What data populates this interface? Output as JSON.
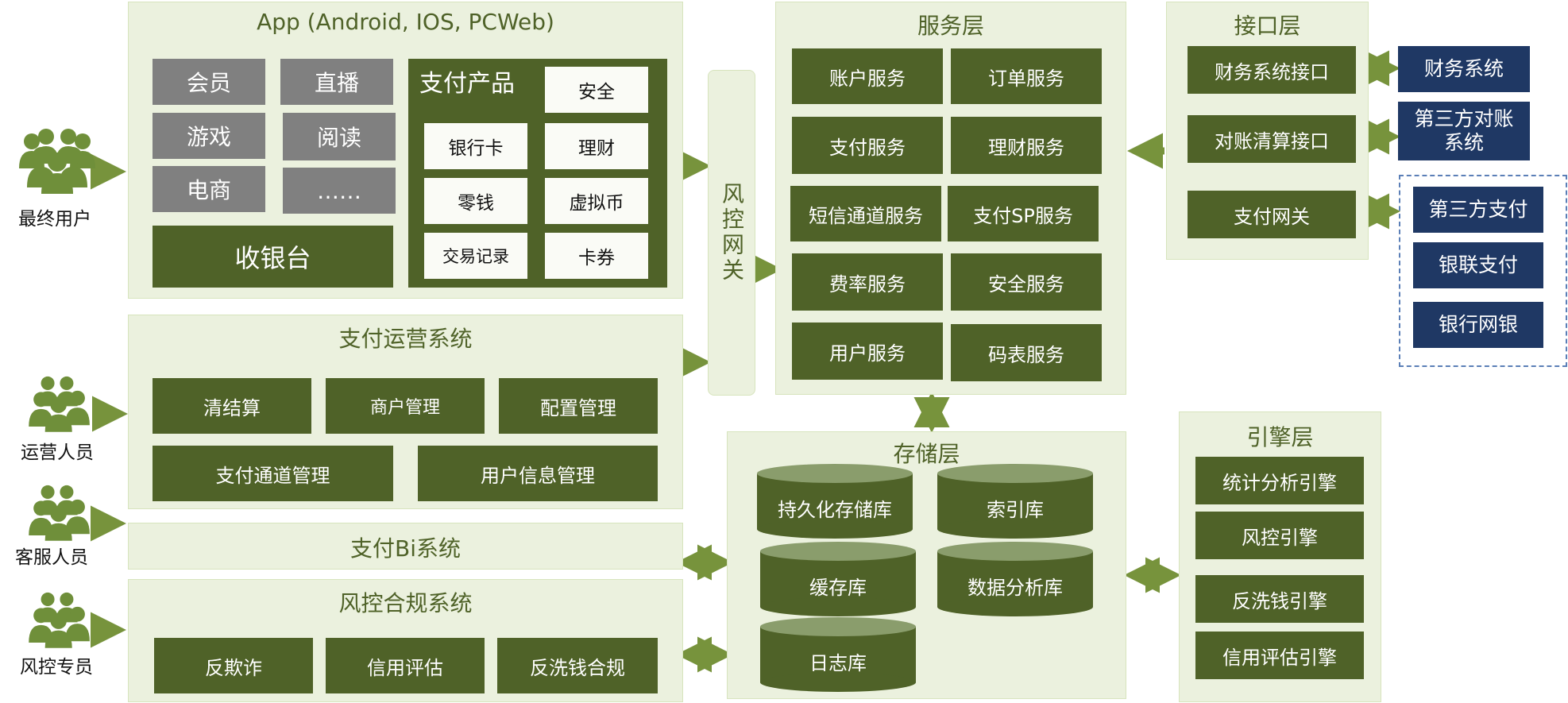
{
  "users": [
    {
      "label": "最终用户"
    },
    {
      "label": "运营人员"
    },
    {
      "label": "客服人员"
    },
    {
      "label": "风控专员"
    }
  ],
  "app": {
    "title": "App (Android, IOS, PCWeb)",
    "modules": [
      "会员",
      "直播",
      "游戏",
      "阅读",
      "电商",
      "……"
    ],
    "cashier": "收银台",
    "pay_products": {
      "title": "支付产品",
      "items": [
        "安全",
        "银行卡",
        "理财",
        "零钱",
        "虚拟币",
        "交易记录",
        "卡券"
      ]
    }
  },
  "ops_system": {
    "title": "支付运营系统",
    "items": [
      "清结算",
      "商户管理",
      "配置管理",
      "支付通道管理",
      "用户信息管理"
    ]
  },
  "bi_system": {
    "title": "支付Bi系统"
  },
  "risk_system": {
    "title": "风控合规系统",
    "items": [
      "反欺诈",
      "信用评估",
      "反洗钱合规"
    ]
  },
  "risk_gateway": {
    "label": "风控网关"
  },
  "service_layer": {
    "title": "服务层",
    "items": [
      "账户服务",
      "订单服务",
      "支付服务",
      "理财服务",
      "短信通道服务",
      "支付SP服务",
      "费率服务",
      "安全服务",
      "用户服务",
      "码表服务"
    ]
  },
  "storage_layer": {
    "title": "存储层",
    "items": [
      "持久化存储库",
      "索引库",
      "缓存库",
      "数据分析库",
      "日志库"
    ]
  },
  "interface_layer": {
    "title": "接口层",
    "items": [
      "财务系统接口",
      "对账清算接口",
      "支付网关"
    ]
  },
  "external": {
    "finance": "财务系统",
    "reconcile": "第三方对账系统",
    "payments": [
      "第三方支付",
      "银联支付",
      "银行网银"
    ]
  },
  "engine_layer": {
    "title": "引擎层",
    "items": [
      "统计分析引擎",
      "风控引擎",
      "反洗钱引擎",
      "信用评估引擎"
    ]
  },
  "colors": {
    "panel_bg": "#ebf1de",
    "dark_green": "#4f6228",
    "arrow_green": "#77933c",
    "gray": "#808080",
    "navy": "#1f3864"
  }
}
